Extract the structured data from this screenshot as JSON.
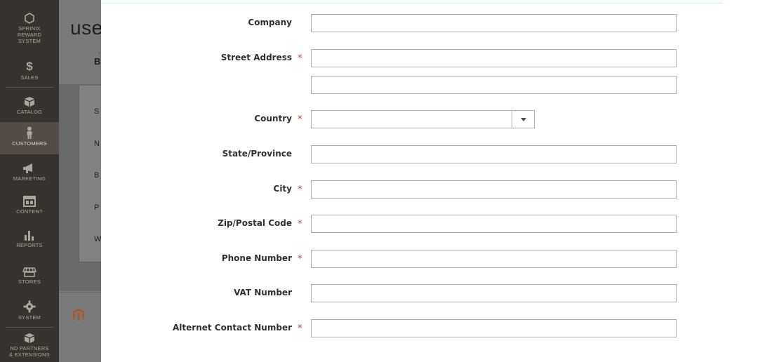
{
  "sidebar": {
    "items": [
      {
        "label": "SPRINIX REWARD SYSTEM",
        "icon": "hexagon-icon"
      },
      {
        "label": "SALES",
        "icon": "dollar-icon"
      },
      {
        "label": "CATALOG",
        "icon": "box-icon"
      },
      {
        "label": "CUSTOMERS",
        "icon": "person-icon",
        "active": true
      },
      {
        "label": "MARKETING",
        "icon": "megaphone-icon"
      },
      {
        "label": "CONTENT",
        "icon": "layout-icon"
      },
      {
        "label": "REPORTS",
        "icon": "bar-chart-icon"
      },
      {
        "label": "STORES",
        "icon": "storefront-icon"
      },
      {
        "label": "SYSTEM",
        "icon": "gear-icon"
      },
      {
        "label": "ND PARTNERS\n& EXTENSIONS",
        "icon": "box-icon"
      }
    ]
  },
  "background_page": {
    "title": "use",
    "tab_label": "B",
    "tab_dot": ".",
    "section_letters": [
      "S",
      "N",
      "B",
      "P",
      "W"
    ]
  },
  "form": {
    "fields": [
      {
        "label": "Company",
        "required": false,
        "type": "text",
        "value": ""
      },
      {
        "label": "Street Address",
        "required": true,
        "type": "text",
        "value": ""
      },
      {
        "label": "",
        "required": false,
        "type": "text",
        "value": ""
      },
      {
        "label": "Country",
        "required": true,
        "type": "select",
        "value": ""
      },
      {
        "label": "State/Province",
        "required": false,
        "type": "text",
        "value": ""
      },
      {
        "label": "City",
        "required": true,
        "type": "text",
        "value": ""
      },
      {
        "label": "Zip/Postal Code",
        "required": true,
        "type": "text",
        "value": ""
      },
      {
        "label": "Phone Number",
        "required": true,
        "type": "text",
        "value": ""
      },
      {
        "label": "VAT Number",
        "required": false,
        "type": "text",
        "value": ""
      },
      {
        "label": "Alternet Contact Number",
        "required": true,
        "type": "text",
        "value": ""
      }
    ],
    "required_mark": "*"
  },
  "colors": {
    "sidebar_bg": "#373330",
    "sidebar_active": "#524d49",
    "required": "#e22626",
    "logo": "#eb5202"
  }
}
